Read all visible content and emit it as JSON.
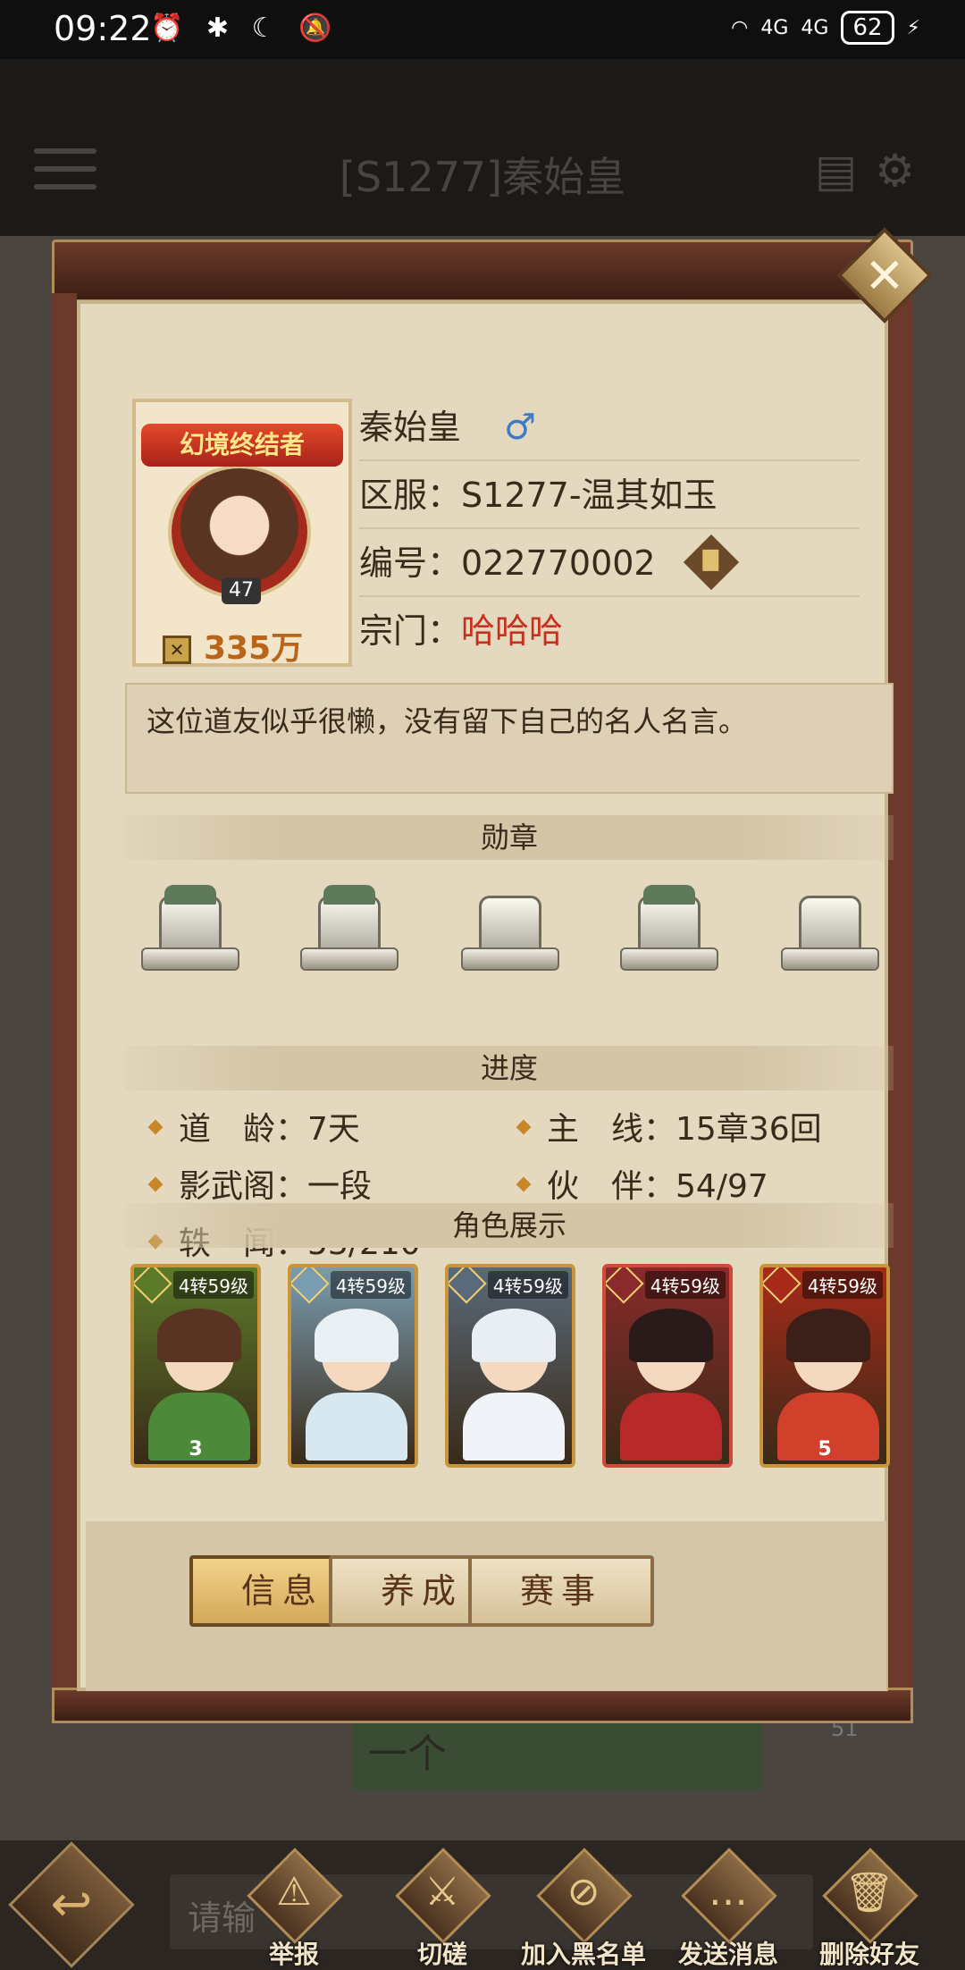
{
  "status": {
    "time": "09:22",
    "left_icons": "⏰ ✱ ☾ 🔕",
    "signal1": "4G",
    "signal2": "4G",
    "battery": "62"
  },
  "header": {
    "title": "[S1277]秦始皇",
    "icons": [
      "menu-icon",
      "card-icon",
      "gear-icon"
    ]
  },
  "profile": {
    "avatar_banner": "幻境终结者",
    "level": "47",
    "power": "335万",
    "name": "秦始皇",
    "gender_symbol": "♂",
    "server_label": "区服：",
    "server_value": "S1277-温其如玉",
    "id_label": "编号：",
    "id_value": "022770002",
    "sect_label": "宗门：",
    "sect_value": "哈哈哈",
    "motto": "这位道友似乎很懒，没有留下自己的名人名言。"
  },
  "sections": {
    "medals": "勋章",
    "progress": "进度",
    "roles": "角色展示"
  },
  "progress": {
    "age_label": "道　龄：",
    "age_value": "7天",
    "main_label": "主　线：",
    "main_value": "15章36回",
    "shadow_label": "影武阁：",
    "shadow_value": "一段",
    "partner_label": "伙　伴：",
    "partner_value": "54/97",
    "news_label": "轶　闻：",
    "news_value": "53/210"
  },
  "roles": [
    {
      "level": "4转59级",
      "stars": "3",
      "colors": [
        "#5c7a2a",
        "#5a3422",
        "#4c8a3a",
        "#c8953a"
      ]
    },
    {
      "level": "4转59级",
      "stars": "",
      "colors": [
        "#7a9cb0",
        "#e8f0f4",
        "#d8e8f0",
        "#c8953a"
      ]
    },
    {
      "level": "4转59级",
      "stars": "",
      "colors": [
        "#5a6a7a",
        "#e8eef4",
        "#f0f4f8",
        "#c8953a"
      ]
    },
    {
      "level": "4转59级",
      "stars": "",
      "colors": [
        "#8a2a2a",
        "#2a1a1a",
        "#b82a2a",
        "#d04a3a"
      ]
    },
    {
      "level": "4转59级",
      "stars": "5",
      "colors": [
        "#a82a1a",
        "#3a2018",
        "#d0402a",
        "#c8953a"
      ]
    }
  ],
  "tabs": [
    "信息",
    "养成",
    "赛事"
  ],
  "chat": {
    "input_placeholder": "请输",
    "bubble_text": "一个",
    "bubble_badge": "51"
  },
  "actions": [
    "举报",
    "切磋",
    "加入黑名单",
    "发送消息",
    "删除好友"
  ],
  "colors": {
    "panel": "#e4d8bf",
    "frame": "#6b3a2a",
    "sect_name": "#c8301e",
    "gender": "#3f7bc2"
  }
}
